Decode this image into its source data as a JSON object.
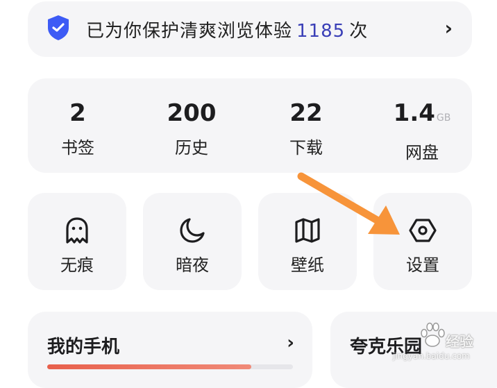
{
  "banner": {
    "prefix": "已为你保护清爽浏览体验",
    "count": "1185",
    "suffix": "次",
    "arrow": "›"
  },
  "stats": [
    {
      "value": "2",
      "unit": "",
      "label": "书签"
    },
    {
      "value": "200",
      "unit": "",
      "label": "历史"
    },
    {
      "value": "22",
      "unit": "",
      "label": "下载"
    },
    {
      "value": "1.4",
      "unit": "GB",
      "label": "网盘"
    }
  ],
  "tools": [
    {
      "label": "无痕",
      "icon": "ghost-icon"
    },
    {
      "label": "暗夜",
      "icon": "moon-icon"
    },
    {
      "label": "壁纸",
      "icon": "wallpaper-book-icon"
    },
    {
      "label": "设置",
      "icon": "settings-hexagon-icon"
    }
  ],
  "phone": {
    "title": "我的手机",
    "arrow": "›",
    "storage_used_fraction": 0.83
  },
  "quark": {
    "title": "夸克乐园"
  },
  "watermark": {
    "brand": "经验",
    "url": "jingyan.baidu.com"
  },
  "colors": {
    "accent": "#3a3fb7",
    "shield": "#3d5bf5",
    "annotation": "#f7943a",
    "progress": "#e8604c"
  }
}
